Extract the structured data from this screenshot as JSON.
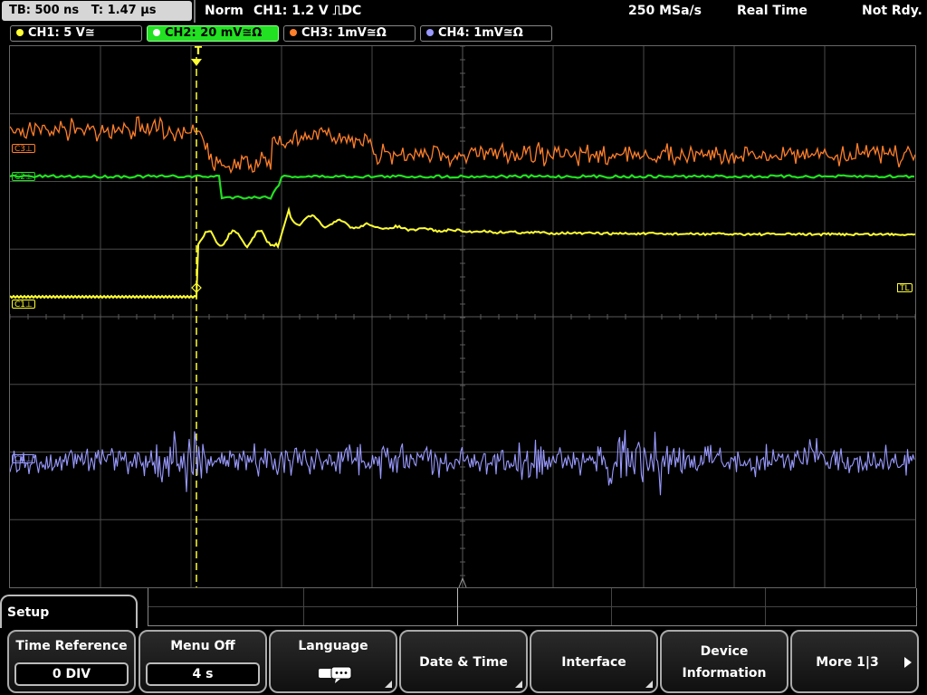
{
  "topbar": {
    "timebase": "TB: 500 ns",
    "trigger_time": "T: 1.47 µs",
    "mode": "Norm",
    "trigger_info": "CH1: 1.2 V ⎍DC",
    "sample_rate": "250 MSa/s",
    "acq_mode": "Real Time",
    "status": "Not Rdy."
  },
  "channels": [
    {
      "label": "CH1: 5 V≅",
      "color": "#ffff33",
      "active": false
    },
    {
      "label": "CH2: 20 mV≅Ω",
      "color": "#22e022",
      "active": true
    },
    {
      "label": "CH3: 1mV≅Ω",
      "color": "#ff7f2a",
      "active": false
    },
    {
      "label": "CH4: 1mV≅Ω",
      "color": "#9999ff",
      "active": false
    }
  ],
  "markers": {
    "c1": "C1⊥",
    "c2": "C2⊥",
    "c3": "C3⊥",
    "c4": "C4⊥",
    "trigger_level": "TL",
    "trigger_pos": "T"
  },
  "colors": {
    "ch1": "#ffff33",
    "ch2": "#22e022",
    "ch3": "#ff7f2a",
    "ch4": "#9999ff",
    "grid": "#4a4a4a",
    "trigger": "#ffff33"
  },
  "menu": {
    "title": "Setup",
    "time_reference": {
      "label": "Time Reference",
      "value": "0 DIV"
    },
    "menu_off": {
      "label": "Menu Off",
      "value": "4 s"
    },
    "language": {
      "label": "Language",
      "icon": "speech-bubbles-icon"
    },
    "date_time": {
      "label": "Date & Time"
    },
    "interface": {
      "label": "Interface"
    },
    "device_info": {
      "line1": "Device",
      "line2": "Information"
    },
    "more": {
      "label": "More 1|3"
    }
  }
}
